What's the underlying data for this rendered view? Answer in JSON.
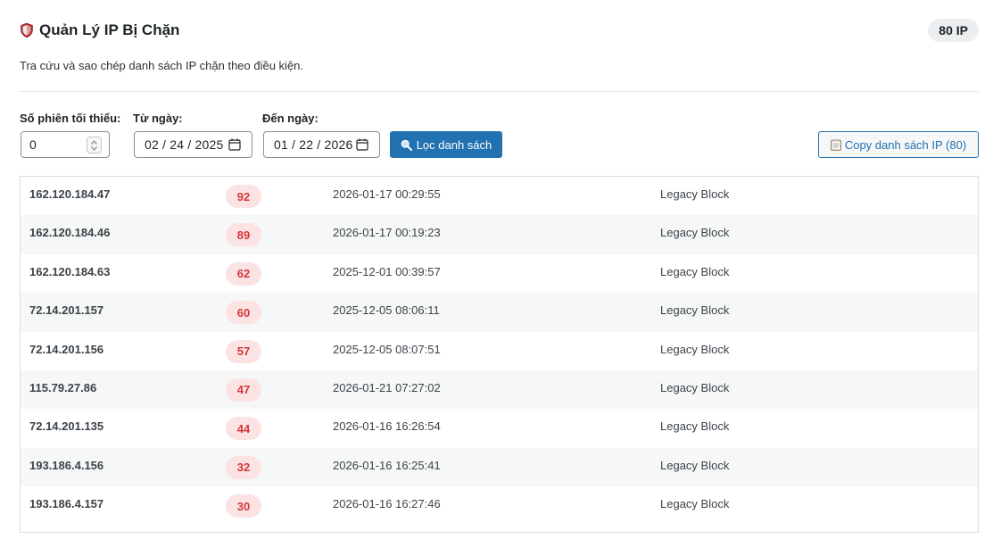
{
  "header": {
    "title": "Quản Lý IP Bị Chặn",
    "count_label": "80 IP",
    "icon": "shield-icon"
  },
  "description": "Tra cứu và sao chép danh sách IP chặn theo điều kiện.",
  "filters": {
    "min_sessions_label": "Số phiên tối thiểu:",
    "min_sessions_value": "0",
    "from_label": "Từ ngày:",
    "from_value": "02 / 24 / 2025",
    "to_label": "Đến ngày:",
    "to_value": "01 / 22 / 2026",
    "filter_button": "Lọc danh sách",
    "copy_button": "Copy danh sách IP (80)"
  },
  "colors": {
    "primary": "#2271b1",
    "badge_bg": "#fbe3e4",
    "badge_text": "#d63638",
    "row_alt": "#f6f7f7"
  },
  "rows": [
    {
      "ip": "162.120.184.47",
      "count": "92",
      "time": "2026-01-17 00:29:55",
      "reason": "Legacy Block"
    },
    {
      "ip": "162.120.184.46",
      "count": "89",
      "time": "2026-01-17 00:19:23",
      "reason": "Legacy Block"
    },
    {
      "ip": "162.120.184.63",
      "count": "62",
      "time": "2025-12-01 00:39:57",
      "reason": "Legacy Block"
    },
    {
      "ip": "72.14.201.157",
      "count": "60",
      "time": "2025-12-05 08:06:11",
      "reason": "Legacy Block"
    },
    {
      "ip": "72.14.201.156",
      "count": "57",
      "time": "2025-12-05 08:07:51",
      "reason": "Legacy Block"
    },
    {
      "ip": "115.79.27.86",
      "count": "47",
      "time": "2026-01-21 07:27:02",
      "reason": "Legacy Block"
    },
    {
      "ip": "72.14.201.135",
      "count": "44",
      "time": "2026-01-16 16:26:54",
      "reason": "Legacy Block"
    },
    {
      "ip": "193.186.4.156",
      "count": "32",
      "time": "2026-01-16 16:25:41",
      "reason": "Legacy Block"
    },
    {
      "ip": "193.186.4.157",
      "count": "30",
      "time": "2026-01-16 16:27:46",
      "reason": "Legacy Block"
    }
  ]
}
